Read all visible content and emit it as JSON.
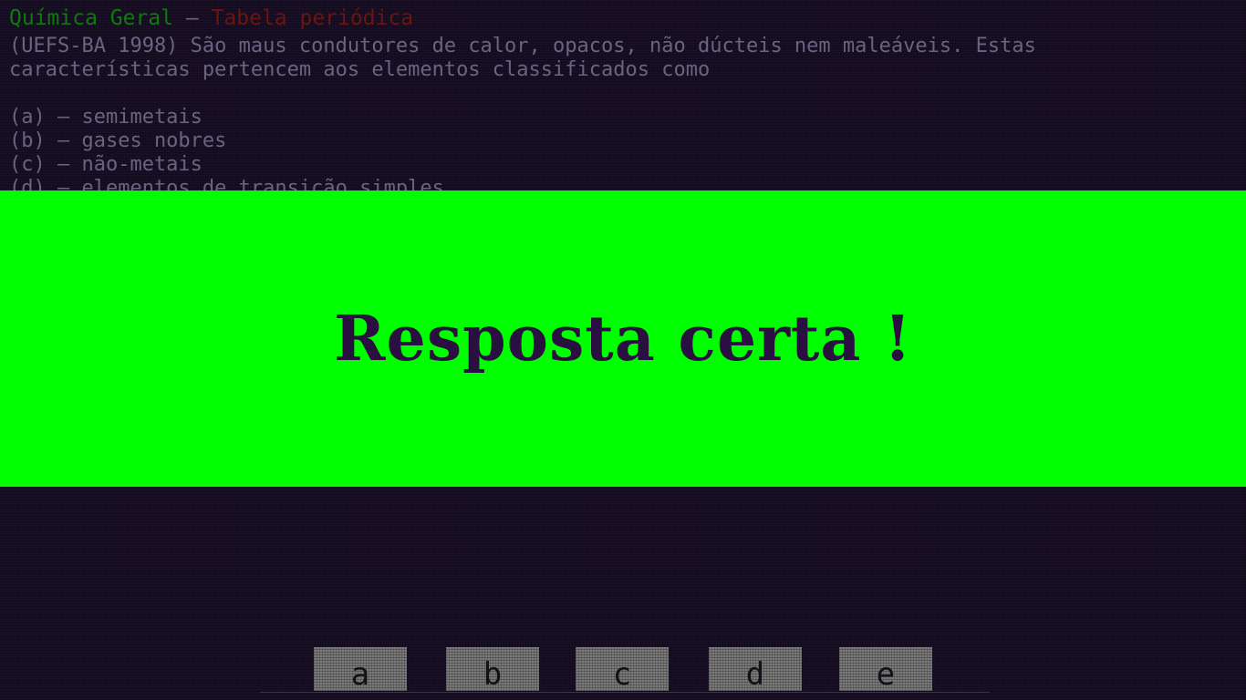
{
  "header": {
    "subject": "Química Geral",
    "separator": " – ",
    "topic": "Tabela periódica"
  },
  "question": {
    "text": "(UEFS-BA 1998) São maus condutores de calor, opacos, não dúcteis nem maleáveis. Estas características pertencem aos elementos classificados como",
    "options": [
      "(a) – semimetais",
      "(b) – gases nobres",
      "(c) – não-metais",
      "(d) – elementos de transição simples"
    ]
  },
  "feedback": {
    "message": "Resposta certa !"
  },
  "answer_buttons": [
    "a",
    "b",
    "c",
    "d",
    "e"
  ],
  "colors": {
    "background": "#1a1028",
    "subject": "#0e7a0e",
    "topic": "#6b1410",
    "banner": "#00ff00",
    "banner_text": "#2a1040"
  }
}
